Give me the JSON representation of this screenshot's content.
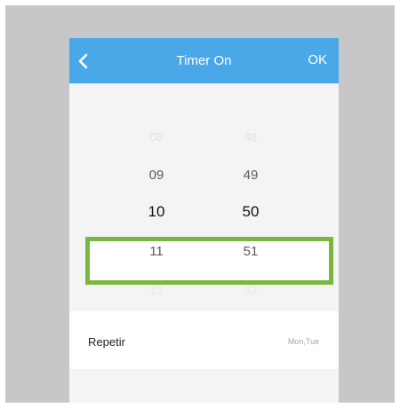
{
  "colors": {
    "header_bg": "#4aa8e8",
    "highlight_border": "#7bb73e",
    "backdrop": "#c7c7c9"
  },
  "header": {
    "back_icon": "chevron-left-icon",
    "title": "Timer On",
    "ok_label": "OK"
  },
  "picker": {
    "hours": [
      "08",
      "09",
      "10",
      "11",
      "12"
    ],
    "minutes": [
      "48",
      "49",
      "50",
      "51",
      "52"
    ],
    "selected_hour": "10",
    "selected_minute": "50"
  },
  "repeat": {
    "label": "Repetir",
    "value": "Mon,Tue"
  }
}
